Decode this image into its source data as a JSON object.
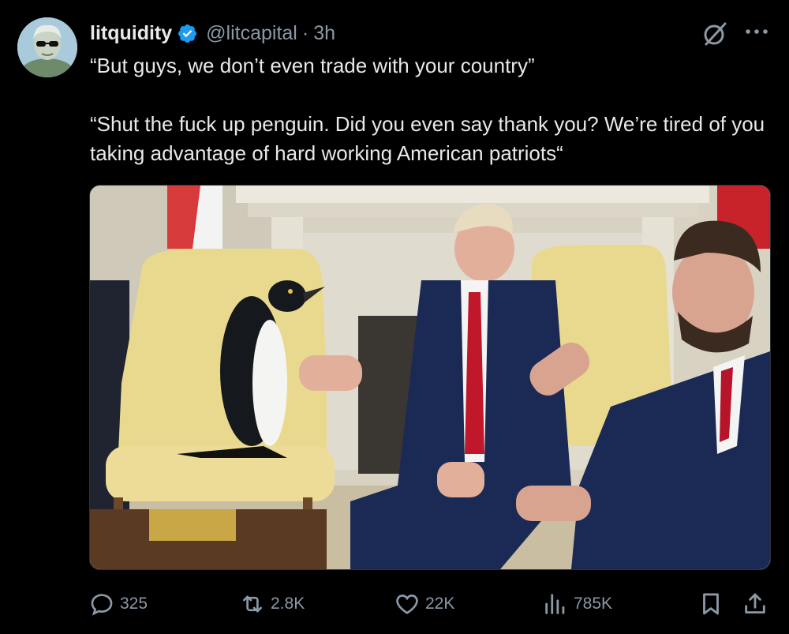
{
  "tweet": {
    "display_name": "litquidity",
    "handle": "@litcapital",
    "separator": "·",
    "time": "3h",
    "text": "“But guys, we don’t even trade with your country”\n\n“Shut the fuck up penguin. Did you even say thank you? We’re tired of you taking advantage of hard working American patriots“"
  },
  "icons": {
    "verified": "verified-badge-icon",
    "grok": "grok-icon",
    "more": "more-options-icon",
    "reply": "reply-icon",
    "retweet": "retweet-icon",
    "like": "like-icon",
    "views": "views-icon",
    "bookmark": "bookmark-icon",
    "share": "share-icon"
  },
  "metrics": {
    "replies": "325",
    "reposts": "2.8K",
    "likes": "22K",
    "views": "785K"
  },
  "colors": {
    "background": "#000000",
    "text": "#e7e9ea",
    "secondary": "#8b98a5",
    "verified": "#1d9bf0"
  }
}
